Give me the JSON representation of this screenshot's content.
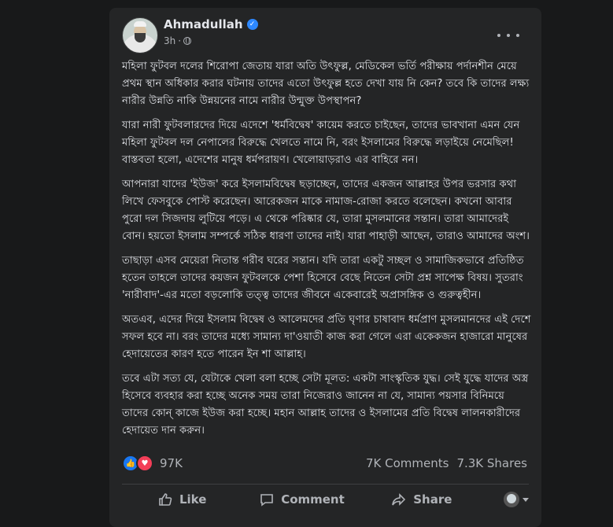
{
  "post": {
    "author": "Ahmadullah",
    "time": "3h",
    "paragraphs": [
      "মহিলা ফুটবল দলের শিরোপা জেতায় যারা অতি উৎফুল্ল, মেডিকেল ভর্তি পরীক্ষায় পর্দানশীন মেয়ে প্রথম স্থান অধিকার করার ঘটনায় তাদের এতো উৎফুল্ল হতে দেখা যায় নি কেন? তবে কি তাদের লক্ষ্য নারীর উন্নতি নাকি উন্নয়নের নামে নারীর উন্মুক্ত উপস্থাপন?",
      "যারা নারী ফুটবলারদের দিয়ে এদেশে 'ধর্মবিদ্বেষ' কায়েম করতে চাইছেন, তাদের ভাবখানা এমন যেন মহিলা ফুটবল দল নেপালের বিরুদ্ধে খেলতে নামে নি, বরং ইসলামের বিরুদ্ধে লড়াইয়ে নেমেছিল! বাস্তবতা হলো, এদেশের মানুষ ধর্মপরায়ণ। খেলোয়াড়রাও এর বাহিরে নন।",
      "আপনারা যাদের 'ইউজ' করে ইসলামবিদ্বেষ ছড়াচ্ছেন, তাদের একজন আল্লাহর উপর ভরসার কথা লিখে ফেসবুকে পোস্ট করেছেন। আরেকজন মাকে নামাজ-রোজা করতে বলেছেন। কখনো আবার পুরো দল সিজদায় লুটিয়ে পড়ে। এ থেকে পরিষ্কার যে, তারা মুসলমানের সন্তান। তারা আমাদেরই বোন। হয়তো ইসলাম সম্পর্কে সঠিক ধারণা তাদের নাই। যারা পাহাড়ী আছেন, তারাও আমাদের অংশ।",
      "তাছাড়া এসব মেয়েরা নিতান্ত গরীব ঘরের সন্তান। যদি তারা একটু সচ্ছল ও সামাজিকভাবে প্রতিষ্ঠিত হতেন তাহলে তাদের কয়জন ফুটবলকে পেশা হিসেবে বেছে নিতেন সেটা প্রশ্ন সাপেক্ষ বিষয়। সুতরাং 'নারীবাদ'-এর মতো বড়লোকি তত্ত্ব তাদের জীবনে একেবারেই অপ্রাসঙ্গিক ও গুরুত্বহীন।",
      "অতএব, এদের দিয়ে ইসলাম বিদ্বেষ ও আলেমদের প্রতি ঘৃণার চাষাবাদ ধর্মপ্রাণ মুসলমানদের এই দেশে সফল হবে না। বরং তাদের মধ্যে সামান্য দা'ওয়াতী কাজ করা গেলে এরা একেকজন হাজারো মানুষের হেদায়েতের কারণ হতে পারেন ইন শা আল্লাহ।",
      "তবে এটা সত্য যে, যেটাকে খেলা বলা হচ্ছে সেটা মূলত: একটা সাংস্কৃতিক যুদ্ধ। সেই যুদ্ধে যাদের অস্ত্র হিসেবে ব্যবহার করা হচ্ছে অনেক সময় তারা নিজেরাও জানেন না যে, সামান্য পয়সার বিনিময়ে তাদের কোন্ কাজে ইউজ করা হচ্ছে। মহান আল্লাহ তাদের ও ইসলামের প্রতি বিদ্বেষ লালনকারীদের হেদায়েত দান করুন।"
    ],
    "reactions_count": "97K",
    "comments": "7K Comments",
    "shares": "7.3K Shares"
  },
  "actions": {
    "like": "Like",
    "comment": "Comment",
    "share": "Share"
  },
  "icons": {
    "verified": "verified-badge-icon",
    "privacy": "globe-icon",
    "more": "more-options-icon",
    "like_reaction": "like-reaction-icon",
    "love_reaction": "love-reaction-icon"
  },
  "colors": {
    "background": "#18191a",
    "card": "#242526",
    "accent": "#2d88ff"
  }
}
